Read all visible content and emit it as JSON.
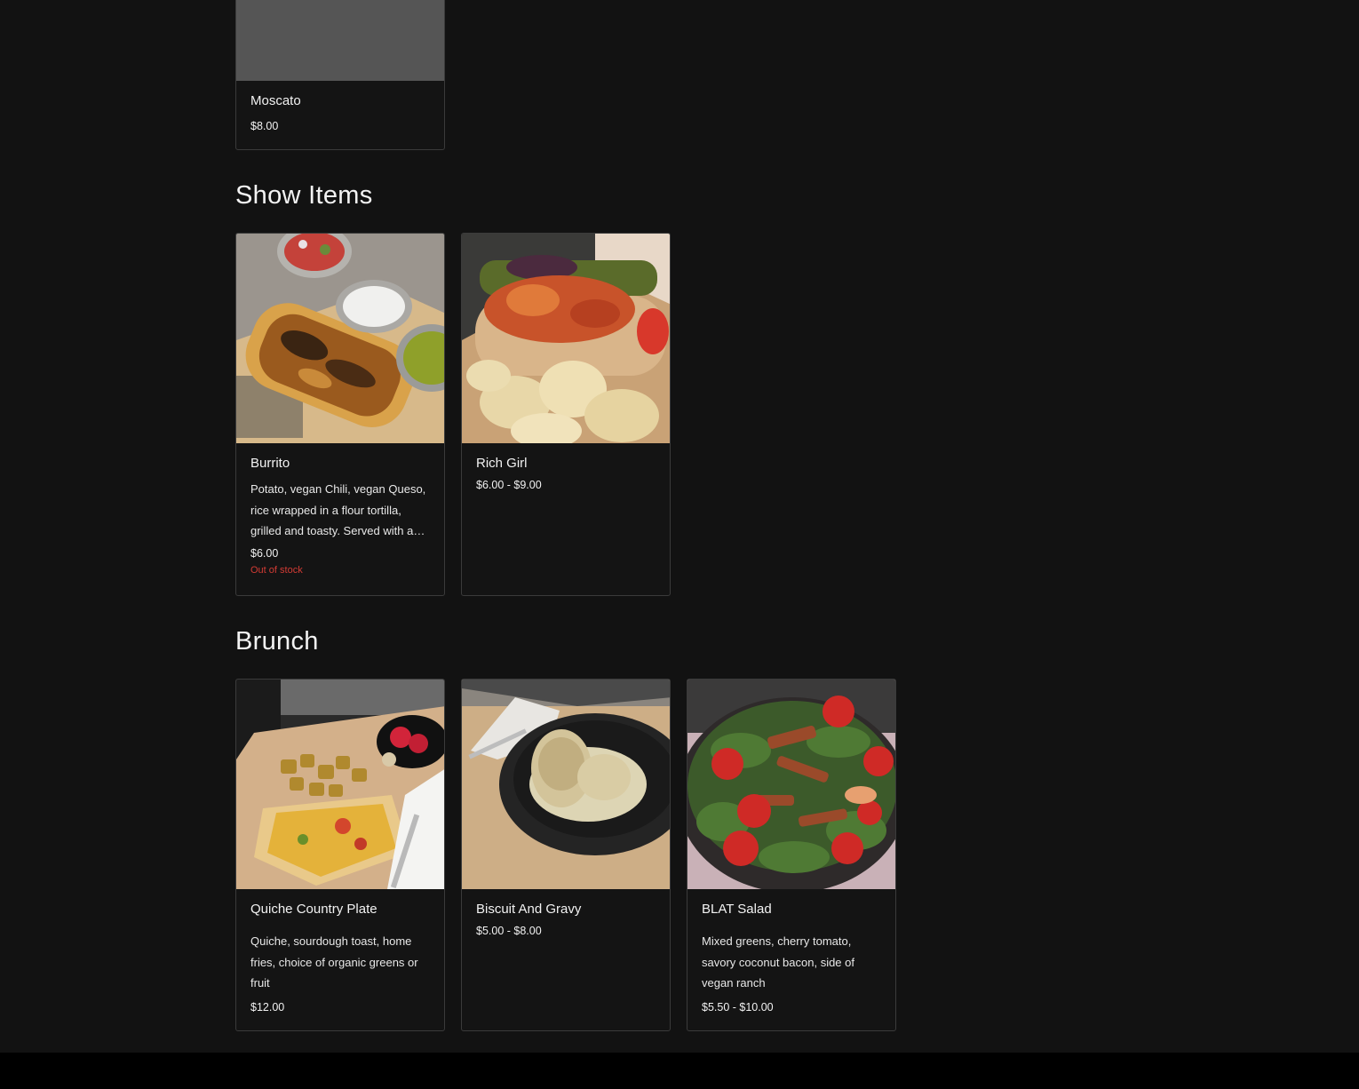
{
  "partial_card": {
    "name": "Moscato",
    "price": "$8.00"
  },
  "sections": [
    {
      "title": "Show Items",
      "items": [
        {
          "name": "Burrito",
          "description": "Potato, vegan Chili, vegan Queso, rice wrapped in a flour tortilla, grilled and toasty. Served with a side of pico, sour cream and jalapeños",
          "price": "$6.00",
          "stock": "Out of stock"
        },
        {
          "name": "Rich Girl",
          "price": "$6.00 - $9.00"
        }
      ]
    },
    {
      "title": "Brunch",
      "items": [
        {
          "name": "Quiche Country Plate",
          "description": "Quiche, sourdough toast, home fries, choice of organic greens or fruit",
          "price": "$12.00"
        },
        {
          "name": "Biscuit And Gravy",
          "price": "$5.00 - $8.00"
        },
        {
          "name": "BLAT Salad",
          "description": "Mixed greens, cherry tomato, savory coconut bacon, side of vegan ranch",
          "price": "$5.50 - $10.00"
        }
      ]
    }
  ]
}
